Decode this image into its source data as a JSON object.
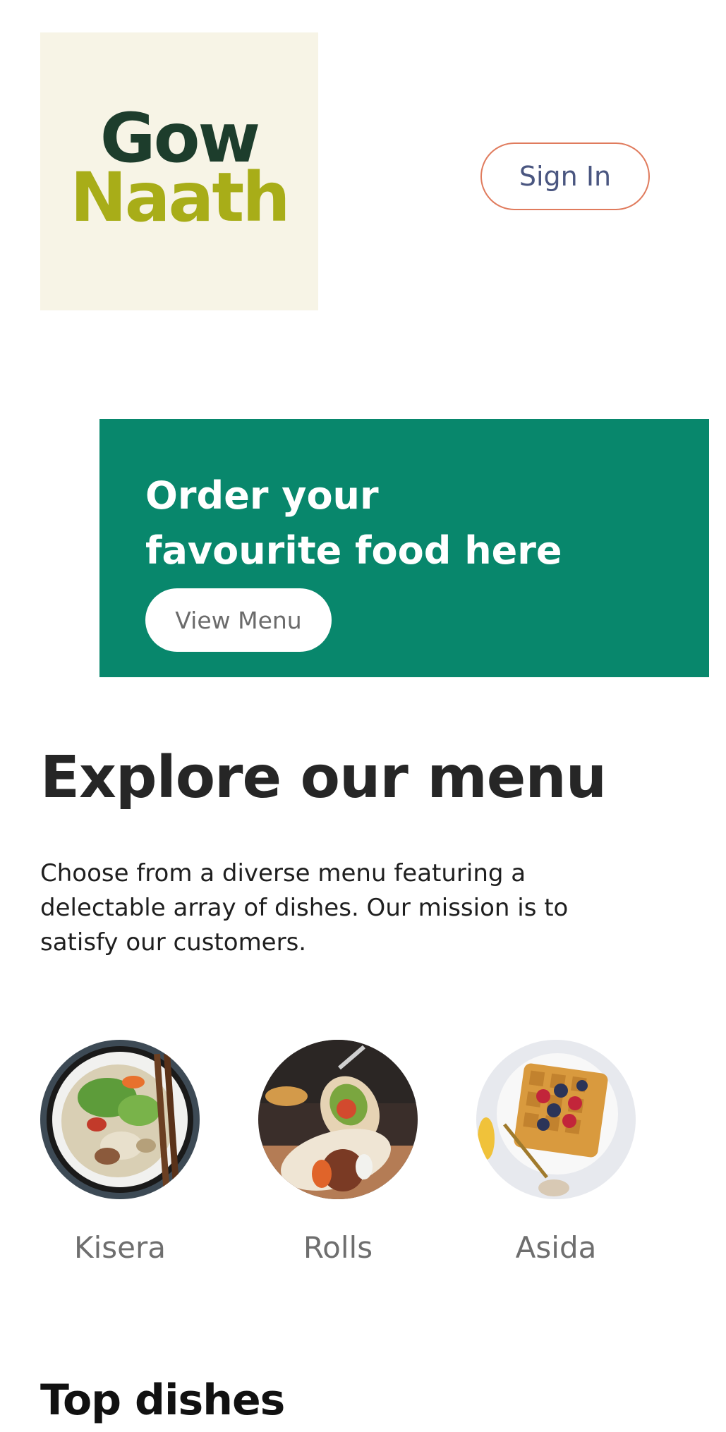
{
  "header": {
    "logo": {
      "line1": "Gow",
      "line2": "Naath"
    },
    "signin_label": "Sign In"
  },
  "hero": {
    "title_line1": "Order your",
    "title_line2": "favourite food here",
    "button_label": "View Menu"
  },
  "explore": {
    "title": "Explore our menu",
    "description": "Choose from a diverse menu featuring a delectable array of dishes. Our mission is to satisfy our customers."
  },
  "menu_items": [
    {
      "label": "Kisera",
      "icon": "noodle-bowl-image"
    },
    {
      "label": "Rolls",
      "icon": "wraps-image"
    },
    {
      "label": "Asida",
      "icon": "waffle-image"
    }
  ],
  "top_dishes": {
    "title": "Top dishes"
  },
  "colors": {
    "brand_green": "#08876c",
    "logo_dark": "#1d3d2c",
    "logo_olive": "#a8ad18",
    "logo_bg": "#f7f4e6",
    "signin_border": "#e07b5d"
  }
}
